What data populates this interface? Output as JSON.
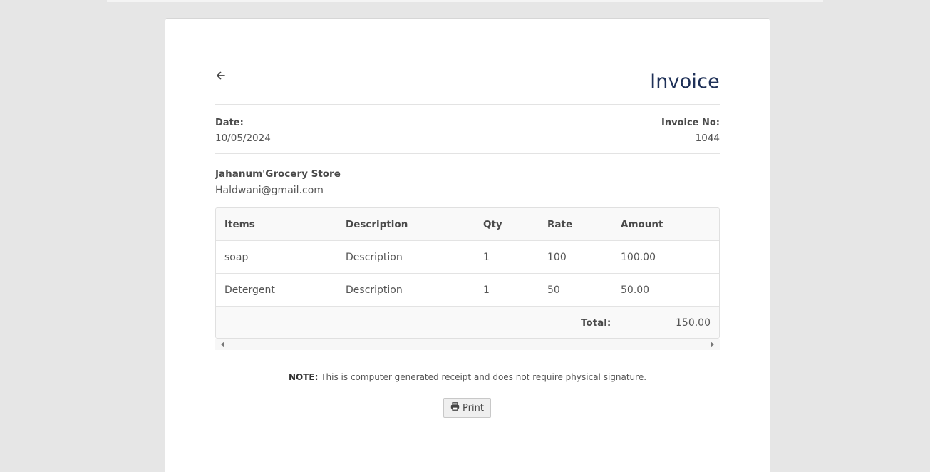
{
  "invoice": {
    "title": "Invoice",
    "date_label": "Date:",
    "date_value": "10/05/2024",
    "invoice_no_label": "Invoice No:",
    "invoice_no_value": "1044",
    "store_name": "Jahanum'Grocery Store",
    "store_email": "Haldwani@gmail.com"
  },
  "table": {
    "headers": [
      "Items",
      "Description",
      "Qty",
      "Rate",
      "Amount"
    ],
    "rows": [
      [
        "soap",
        "Description",
        "1",
        "100",
        "100.00"
      ],
      [
        "Detergent",
        "Description",
        "1",
        "50",
        "50.00"
      ]
    ],
    "total_label": "Total:",
    "total_value": "150.00"
  },
  "note": {
    "bold": "NOTE:",
    "text": "This is computer generated receipt and does not require physical signature."
  },
  "print_label": "Print",
  "icons": {
    "back": "arrow-left-icon",
    "print": "printer-icon"
  },
  "colors": {
    "title": "#1f3158",
    "page_bg": "#e6e6e6"
  }
}
